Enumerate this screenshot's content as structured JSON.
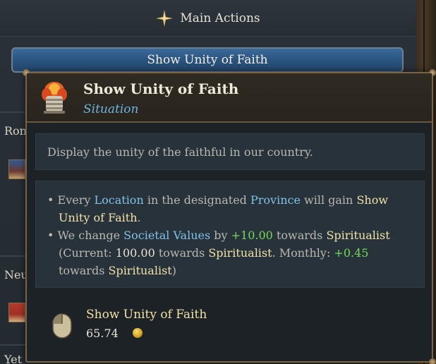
{
  "header": {
    "title": "Main Actions",
    "icon": "compass-star-icon"
  },
  "action_button": {
    "label": "Show Unity of Faith"
  },
  "side": {
    "label_1": "Ron",
    "label_2": "Neu",
    "label_3": "Yet"
  },
  "tooltip": {
    "title": "Show Unity of Faith",
    "subtitle": "Situation",
    "icon": "situation-incense-icon",
    "description": "Display the unity of the faithful in our country.",
    "effect_1": {
      "bullet": "•",
      "t1": "Every ",
      "location": "Location",
      "t2": " in the designated ",
      "province": "Province",
      "t3": " will gain ",
      "gain": "Show Unity of Faith",
      "t4": "."
    },
    "effect_2": {
      "bullet": "•",
      "t1": "We change ",
      "societal_values": "Societal Values",
      "t2": " by ",
      "change": "+10.00",
      "t3": " towards ",
      "target": "Spiritualist",
      "t4": "(Current: ",
      "current": "100.00",
      "t5": " towards ",
      "target_2": "Spiritualist",
      "t6": ". Monthly: ",
      "monthly": "+0.45",
      "t7": "towards ",
      "target_3": "Spiritualist",
      "t8": ")"
    },
    "cost": {
      "title": "Show Unity of Faith",
      "value": "65.74",
      "icon": "gold-coin-icon",
      "mouse_icon": "mouse-left-click-icon"
    }
  },
  "colors": {
    "link_blue": "#7fc1e8",
    "keyword_gold": "#f0e2a8",
    "positive_green": "#74d95a",
    "button_blue": "#2b5480"
  }
}
